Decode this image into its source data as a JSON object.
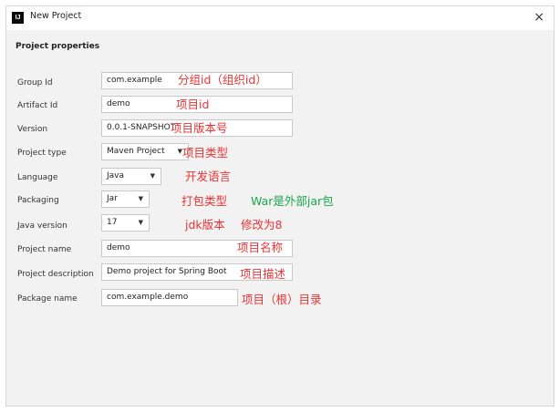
{
  "window": {
    "title": "New Project",
    "icon_text": "IJ",
    "close_glyph": "×"
  },
  "section_title": "Project properties",
  "fields": {
    "group_id": {
      "label": "Group Id",
      "value": "com.example"
    },
    "artifact_id": {
      "label": "Artifact Id",
      "value": "demo"
    },
    "version": {
      "label": "Version",
      "value": "0.0.1-SNAPSHOT"
    },
    "project_type": {
      "label": "Project type",
      "value": "Maven Project"
    },
    "language": {
      "label": "Language",
      "value": "Java"
    },
    "packaging": {
      "label": "Packaging",
      "value": "Jar"
    },
    "java_version": {
      "label": "Java version",
      "value": "17"
    },
    "project_name": {
      "label": "Project name",
      "value": "demo"
    },
    "project_description": {
      "label": "Project description",
      "value": "Demo project for Spring Boot"
    },
    "package_name": {
      "label": "Package name",
      "value": "com.example.demo"
    }
  },
  "annotations": {
    "group_id": "分组id（组织id）",
    "artifact_id": "项目id",
    "version": "项目版本号",
    "project_type": "项目类型",
    "language": "开发语言",
    "packaging": "打包类型",
    "packaging_note": "War是外部jar包",
    "java_version": "jdk版本",
    "java_version_note": "修改为8",
    "project_name": "项目名称",
    "project_description": "项目描述",
    "package_name": "项目（根）目录"
  },
  "icons": {
    "dropdown": "chevron-down-icon",
    "close": "close-icon"
  },
  "colors": {
    "annotation_red": "#ea3333",
    "annotation_green": "#1aa84a"
  }
}
